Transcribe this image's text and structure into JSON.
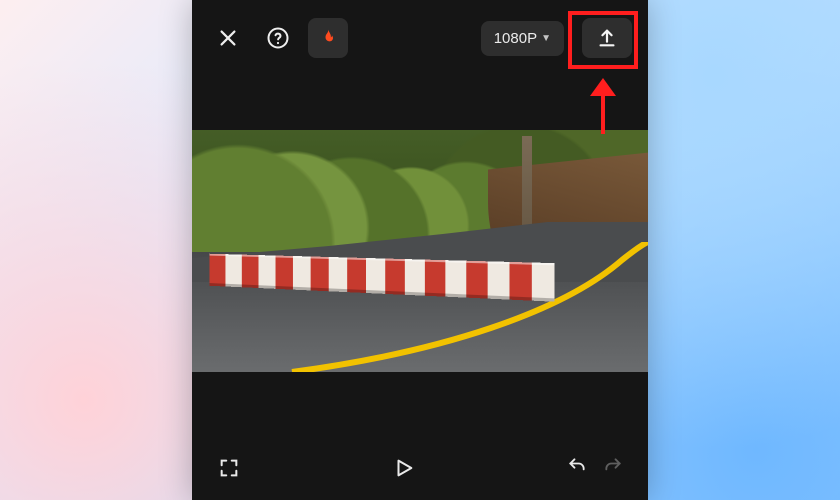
{
  "topbar": {
    "close_icon": "close-icon",
    "help_icon": "help-icon",
    "fire_icon": "fire-icon",
    "resolution_label": "1080P",
    "export_icon": "upload-icon"
  },
  "bottombar": {
    "fullscreen_icon": "fullscreen-icon",
    "play_icon": "play-icon",
    "undo_icon": "undo-icon",
    "redo_icon": "redo-icon"
  },
  "annotation": {
    "highlight_target": "export-button",
    "arrow_direction": "up"
  },
  "colors": {
    "panel_bg": "#151515",
    "button_bg": "#2e2e2e",
    "accent_fire": "#ff4b1f",
    "annotation": "#ff1e1e"
  }
}
